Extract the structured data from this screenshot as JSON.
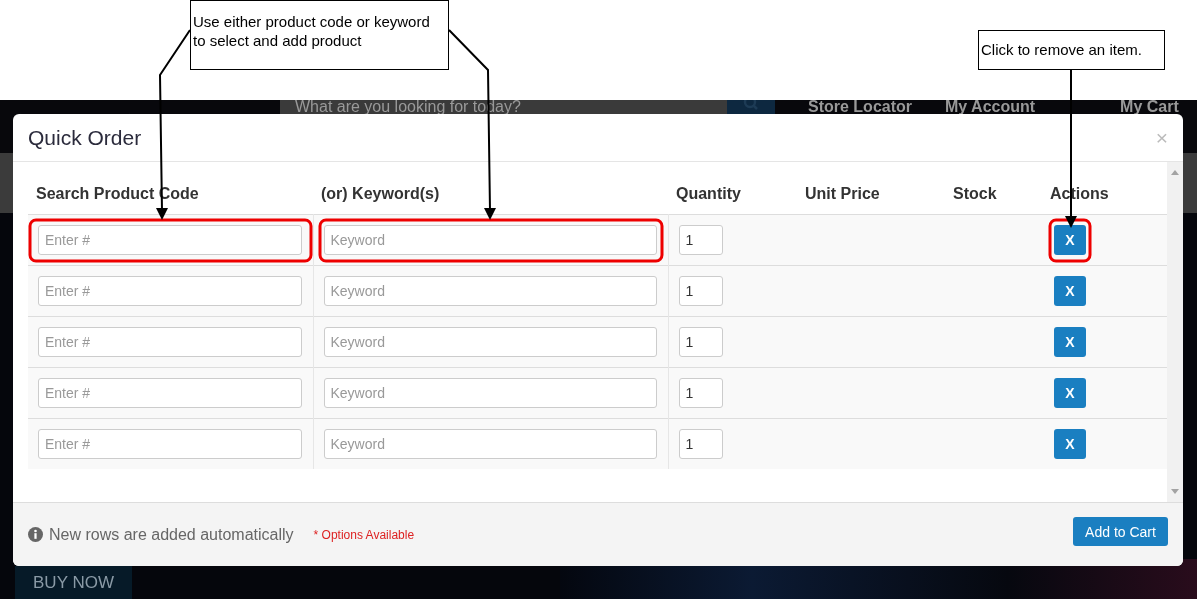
{
  "site": {
    "search_placeholder": "What are you looking for today?",
    "nav_links": [
      "Store Locator",
      "My Account",
      "My Cart"
    ],
    "banner_button": "BUY  NOW"
  },
  "modal": {
    "title": "Quick Order",
    "close": "×",
    "columns": [
      "Search Product Code",
      "(or) Keyword(s)",
      "Quantity",
      "Unit Price",
      "Stock",
      "Actions"
    ],
    "rows": [
      {
        "code_placeholder": "Enter #",
        "keyword_placeholder": "Keyword",
        "quantity": "1",
        "remove": "X",
        "highlighted": true
      },
      {
        "code_placeholder": "Enter #",
        "keyword_placeholder": "Keyword",
        "quantity": "1",
        "remove": "X",
        "highlighted": false
      },
      {
        "code_placeholder": "Enter #",
        "keyword_placeholder": "Keyword",
        "quantity": "1",
        "remove": "X",
        "highlighted": false
      },
      {
        "code_placeholder": "Enter #",
        "keyword_placeholder": "Keyword",
        "quantity": "1",
        "remove": "X",
        "highlighted": false
      },
      {
        "code_placeholder": "Enter #",
        "keyword_placeholder": "Keyword",
        "quantity": "1",
        "remove": "X",
        "highlighted": false
      }
    ],
    "footer_note": "New rows are added automatically",
    "options_note": "* Options Available",
    "add_button": "Add to Cart"
  },
  "annotations": [
    {
      "kind": "fields",
      "text": "Use either product code or keyword to select and add product"
    },
    {
      "kind": "remove",
      "text": "Click to remove an item."
    }
  ]
}
